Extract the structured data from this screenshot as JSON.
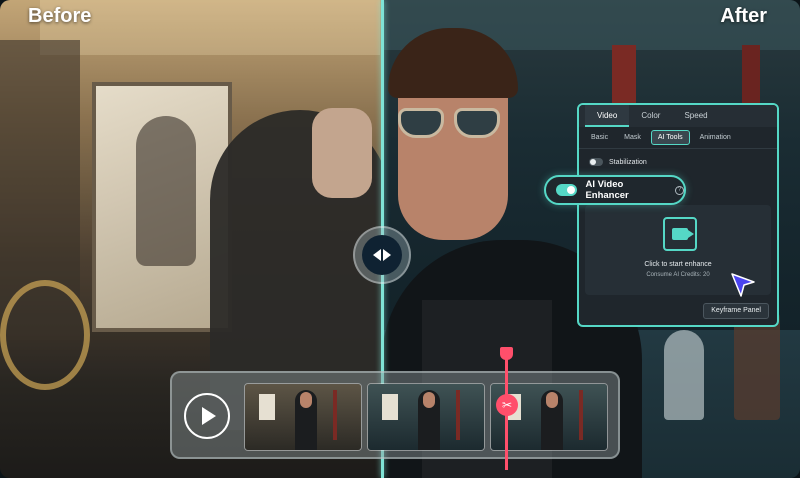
{
  "labels": {
    "before": "Before",
    "after": "After"
  },
  "panel": {
    "tabs": [
      "Video",
      "Color",
      "Speed"
    ],
    "active_tab": "Video",
    "subtabs": [
      "Basic",
      "Mask",
      "AI Tools",
      "Animation"
    ],
    "active_subtab": "AI Tools",
    "stabilization_label": "Stabilization",
    "ai_enhancer_label": "AI Video Enhancer",
    "help_glyph": "?",
    "enhance_title": "Click to start enhance",
    "enhance_credits": "Consume AI Credits:  20",
    "keyframe_button": "Keyframe Panel"
  },
  "icons": {
    "compare_handle": "left-right-arrows-icon",
    "play": "play-icon",
    "cut": "scissors-icon",
    "enhance": "video-enhance-icon",
    "cursor": "cursor-arrow-icon"
  },
  "colors": {
    "accent": "#55d8c6",
    "playhead": "#ff4f6b",
    "cursor": "#4b44f0"
  },
  "timeline": {
    "clip_count": 3,
    "cut_glyph": "✂"
  }
}
